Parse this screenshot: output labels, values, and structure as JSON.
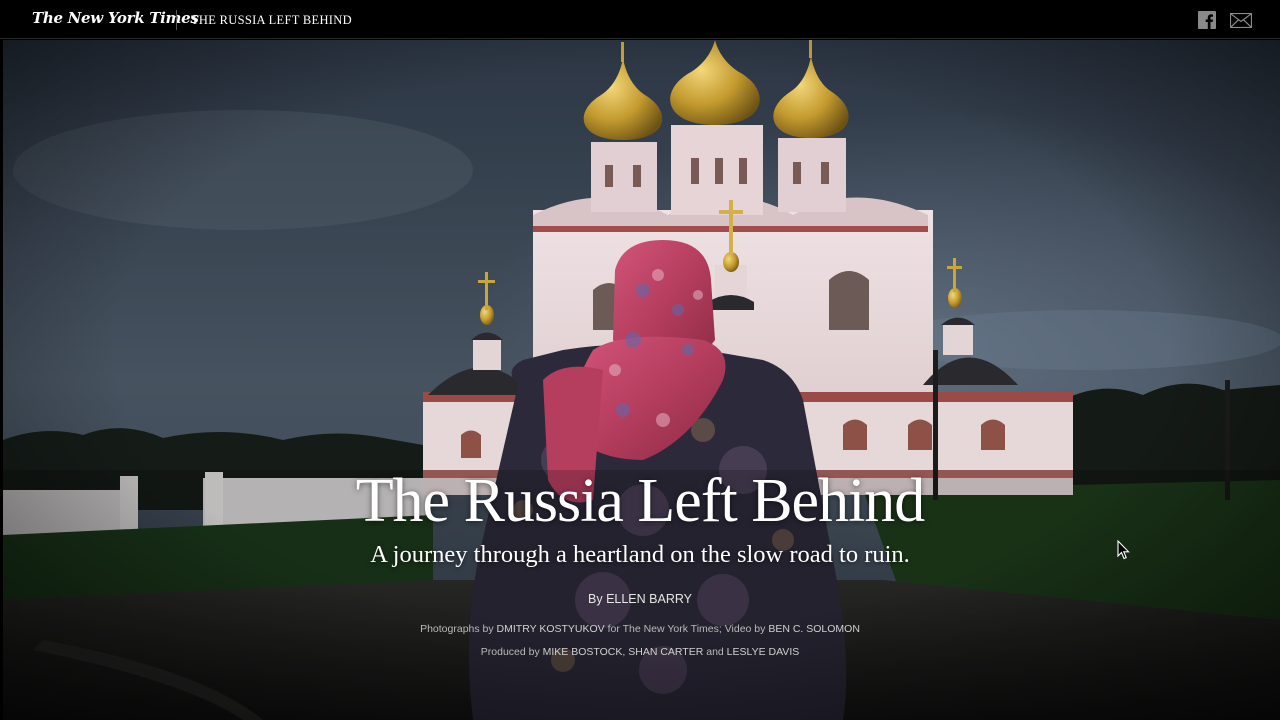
{
  "header": {
    "logo_text": "The New York Times",
    "section_title": "THE RUSSIA LEFT BEHIND",
    "share_icons": [
      "facebook-icon",
      "mail-icon"
    ]
  },
  "hero": {
    "headline": "The Russia Left Behind",
    "subheadline": "A journey through a heartland on the slow road to ruin.",
    "byline_prefix": "By ",
    "byline_author": "ELLEN BARRY",
    "photo_credit_prefix": "Photographs by ",
    "photo_credit_name": "DMITRY KOSTYUKOV",
    "photo_credit_mid": " for The New York Times; Video by ",
    "video_credit_name": "BEN C. SOLOMON",
    "produced_prefix": "Produced by ",
    "producer_1": "MIKE BOSTOCK",
    "producer_sep": ", ",
    "producer_2": "SHAN CARTER",
    "producer_and": " and ",
    "producer_3": "LESLYE DAVIS"
  },
  "colors": {
    "topbar_bg": "#000000",
    "sky": "#3b4654",
    "gold_dome": "#c9a53a",
    "church_wall": "#e9dcdc",
    "scarf_pink": "#c2445f"
  }
}
